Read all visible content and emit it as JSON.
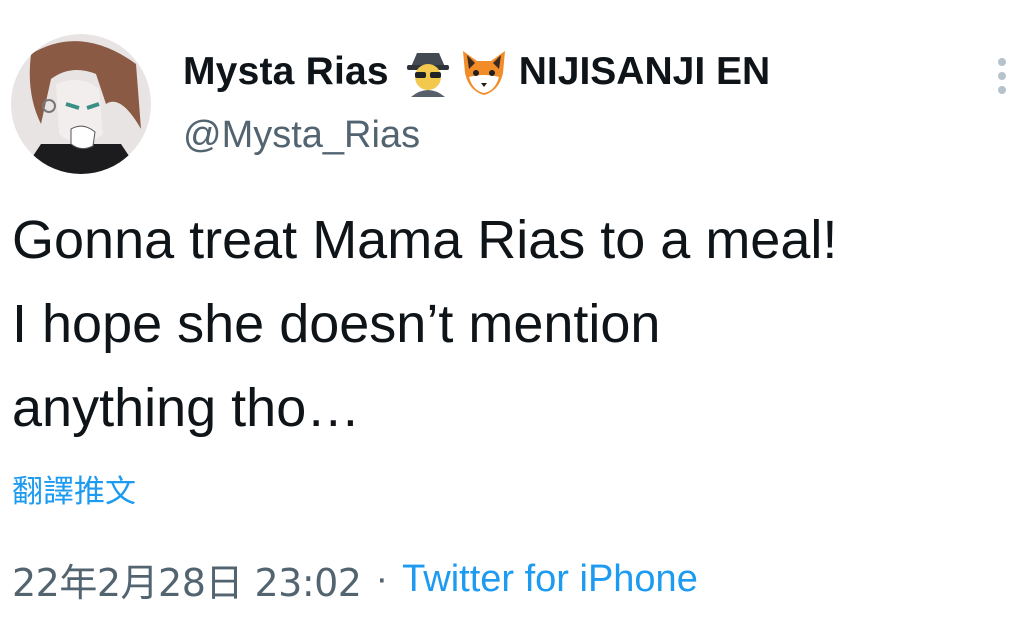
{
  "author": {
    "display_name": "Mysta Rias",
    "name_emojis": [
      "spy-emoji",
      "fox-emoji"
    ],
    "org_name": "NIJISANJI EN",
    "handle": "@Mysta_Rias"
  },
  "tweet": {
    "text": "Gonna treat Mama Rias to a meal!\nI hope she doesn’t mention\nanything tho…",
    "translate_label": "翻譯推文",
    "date": "22年2月28日 23:02",
    "separator": "·",
    "source": "Twitter for iPhone"
  },
  "colors": {
    "link": "#1d9bf0",
    "secondary_text": "#536471",
    "primary_text": "#0f1419"
  }
}
